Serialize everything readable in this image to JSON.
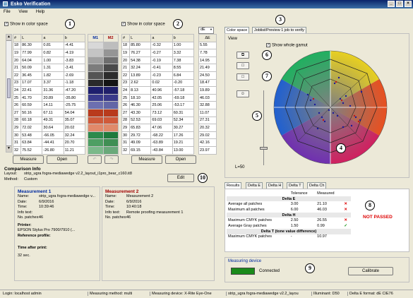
{
  "window": {
    "title": "Esko Verification",
    "controls": [
      "_",
      "□",
      "×"
    ]
  },
  "menu": [
    "File",
    "View",
    "Help"
  ],
  "left_table": {
    "checkbox_label": "Show in color space",
    "headers": [
      "#",
      "L",
      "a",
      "b"
    ],
    "rows": [
      [
        "18",
        "86.30",
        "0.81",
        "-4.41"
      ],
      [
        "19",
        "77.99",
        "0.82",
        "-4.19"
      ],
      [
        "20",
        "64.04",
        "1.00",
        "-3.83"
      ],
      [
        "21",
        "50.09",
        "1.31",
        "-3.41"
      ],
      [
        "22",
        "36.45",
        "1.82",
        "-2.69"
      ],
      [
        "23",
        "17.07",
        "3.37",
        "-1.18"
      ],
      [
        "24",
        "22.41",
        "31.36",
        "-47.20"
      ],
      [
        "25",
        "41.70",
        "20.89",
        "-35.80"
      ],
      [
        "26",
        "60.59",
        "14.11",
        "-25.75"
      ],
      [
        "27",
        "50.16",
        "67.11",
        "54.04"
      ],
      [
        "28",
        "60.18",
        "49.31",
        "35.07"
      ],
      [
        "29",
        "72.02",
        "30.64",
        "20.02"
      ],
      [
        "30",
        "53.48",
        "-66.05",
        "32.24"
      ],
      [
        "31",
        "63.84",
        "-44.41",
        "20.70"
      ],
      [
        "32",
        "75.52",
        "-26.80",
        "11.21"
      ]
    ]
  },
  "swatches": {
    "headers": [
      "M1",
      "M2"
    ],
    "m1": [
      "#d8d8d8",
      "#c4c4c4",
      "#a0a0a0",
      "#7c7c7c",
      "#545454",
      "#2a2a2a",
      "#1e1f6e",
      "#3b3c8e",
      "#6c6fb0",
      "#b93a1c",
      "#cf5a3a",
      "#e2896a",
      "#2d8a4c",
      "#4e9f63",
      "#7bb98a"
    ],
    "m2": [
      "#bdbdbd",
      "#959595",
      "#6e6e6e",
      "#4a4a4a",
      "#2c2c2c",
      "#141414",
      "#20206a",
      "#3a3a8a",
      "#6266a6",
      "#b83a1c",
      "#d05a3a",
      "#e08a6a",
      "#1f7a3c",
      "#3f8f53",
      "#6aa97a"
    ]
  },
  "right_table": {
    "checkbox_label": "Show in color space",
    "headers": [
      "#",
      "L",
      "a",
      "b"
    ],
    "rows": [
      [
        "18",
        "85.80",
        "-0.32",
        "1.00"
      ],
      [
        "19",
        "76.27",
        "-0.27",
        "3.32"
      ],
      [
        "20",
        "54.38",
        "-0.19",
        "7.38"
      ],
      [
        "21",
        "32.24",
        "-0.41",
        "8.55"
      ],
      [
        "22",
        "13.89",
        "-0.23",
        "6.84"
      ],
      [
        "23",
        "2.62",
        "0.02",
        "-0.20"
      ],
      [
        "24",
        "8.13",
        "40.96",
        "-57.18"
      ],
      [
        "25",
        "18.10",
        "42.05",
        "-69.18"
      ],
      [
        "26",
        "46.30",
        "25.06",
        "-53.17"
      ],
      [
        "27",
        "43.30",
        "73.12",
        "60.31"
      ],
      [
        "28",
        "52.53",
        "69.03",
        "52.34"
      ],
      [
        "29",
        "65.83",
        "47.06",
        "30.27"
      ],
      [
        "30",
        "29.72",
        "-68.22",
        "17.26"
      ],
      [
        "31",
        "49.09",
        "-63.89",
        "19.21"
      ],
      [
        "32",
        "69.15",
        "-43.84",
        "13.00"
      ]
    ]
  },
  "de_table": {
    "dropdown": "dE",
    "header": "ΔE",
    "rows": [
      "5.55",
      "7.78",
      "14.95",
      "21.49",
      "24.50",
      "18.47",
      "19.89",
      "46.03",
      "32.88",
      "11.07",
      "27.31",
      "20.32",
      "29.02",
      "42.16",
      "23.97"
    ]
  },
  "left_buttons": {
    "measure": "Measure",
    "open": "Open"
  },
  "right_buttons": {
    "measure": "Measure",
    "open": "Open"
  },
  "undo_redo": {
    "undo": "↶",
    "redo": "↷"
  },
  "comparison": {
    "title": "Comparison Info",
    "layout_label": "Layout:",
    "layout_value": "strip_ugra fogra-mediawedge v2.2_layout_i1pro_bear_c160.it8",
    "method_label": "Method:",
    "method_value": "Custom",
    "edit_button": "Edit"
  },
  "measurement1": {
    "title": "Measurement 1",
    "name_label": "Name:",
    "name_value": "strip_ugra fogra-mediawedge v...",
    "date_label": "Date:",
    "date_value": "6/9/2016",
    "time_label": "Time:",
    "time_value": "10:39:46",
    "info_label": "Info text:",
    "info_value": "",
    "patches_label": "No. patches:",
    "patches_value": "46",
    "printer_label": "Printer:",
    "printer_value": "EPSON Stylus Pro 7900/7910 (...",
    "ref_label": "Reference profile:",
    "tap_label": "Time after print:",
    "tap_value": "32 sec."
  },
  "measurement2": {
    "title": "Measurement 2",
    "name_label": "Name:",
    "name_value": "Measurement 2",
    "date_label": "Date:",
    "date_value": "6/9/2016",
    "time_label": "Time:",
    "time_value": "10:40:18",
    "info_label": "Info text:",
    "info_value": "Remote proofing measurement 1",
    "patches_label": "No. patches:",
    "patches_value": "46"
  },
  "colorspace": {
    "tabs": [
      "Color space",
      "Joblist/Preview 1 job to verify"
    ],
    "view_label": "View",
    "show_gamut_label": "Show whole gamut",
    "l_label": "L=50"
  },
  "results": {
    "tabs": [
      "Results",
      "Delta E",
      "Delta H",
      "Delta T",
      "Delta Ch"
    ],
    "col_tolerance": "Tolerance",
    "col_measured": "Measured",
    "sections": [
      {
        "title": "Delta E",
        "rows": [
          {
            "label": "Average all patches",
            "tol": "3.00",
            "meas": "21.10",
            "status": "fail"
          },
          {
            "label": "Maximum all patches",
            "tol": "6.00",
            "meas": "46.03",
            "status": "fail"
          }
        ]
      },
      {
        "title": "Delta H",
        "rows": [
          {
            "label": "Maximum CMYK patches",
            "tol": "2.50",
            "meas": "26.55",
            "status": "fail"
          },
          {
            "label": "Average Gray patches",
            "tol": "1.50",
            "meas": "0.99",
            "status": "pass"
          }
        ]
      },
      {
        "title": "Delta T (tone value difference)",
        "rows": [
          {
            "label": "Maximum CMYK patches",
            "tol": "-",
            "meas": "10.97",
            "status": "none"
          }
        ]
      }
    ],
    "verdict": "NOT PASSED"
  },
  "device": {
    "title": "Measuring device",
    "status": "Connected",
    "calibrate": "Calibrate",
    "status_color": "#1a8a1a"
  },
  "statusbar": [
    "Login: localhost admin",
    "Measuring method: multi",
    "Measuring device: X-Rite Eye-One",
    "strip_ugra fogra-mediawedge v2.2_layou",
    "Illuminant: D50",
    "Delta E format: dE CIE76"
  ],
  "callouts": [
    "1",
    "2",
    "3",
    "4",
    "5",
    "6",
    "7",
    "8",
    "9",
    "10"
  ]
}
